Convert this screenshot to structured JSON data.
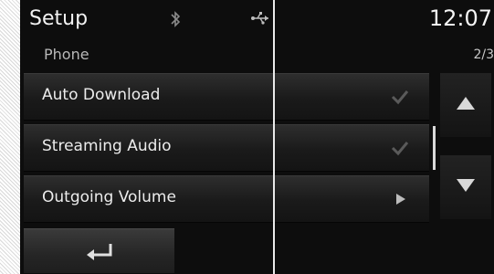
{
  "header": {
    "title": "Setup",
    "time": "12:07",
    "icons": [
      "bluetooth-icon",
      "usb-icon"
    ]
  },
  "section": {
    "label": "Phone",
    "page_indicator": "2/3"
  },
  "menu": {
    "items": [
      {
        "label": "Auto Download",
        "indicator": "check-icon"
      },
      {
        "label": "Streaming Audio",
        "indicator": "check-icon"
      },
      {
        "label": "Outgoing Volume",
        "indicator": "arrow-right-icon"
      }
    ]
  },
  "controls": {
    "scroll_up": "up-arrow-icon",
    "scroll_down": "down-arrow-icon",
    "back": "back-arrow-icon"
  },
  "colors": {
    "background": "#0d0d0d",
    "text": "#ececec",
    "divider": "#e9e9e9"
  }
}
